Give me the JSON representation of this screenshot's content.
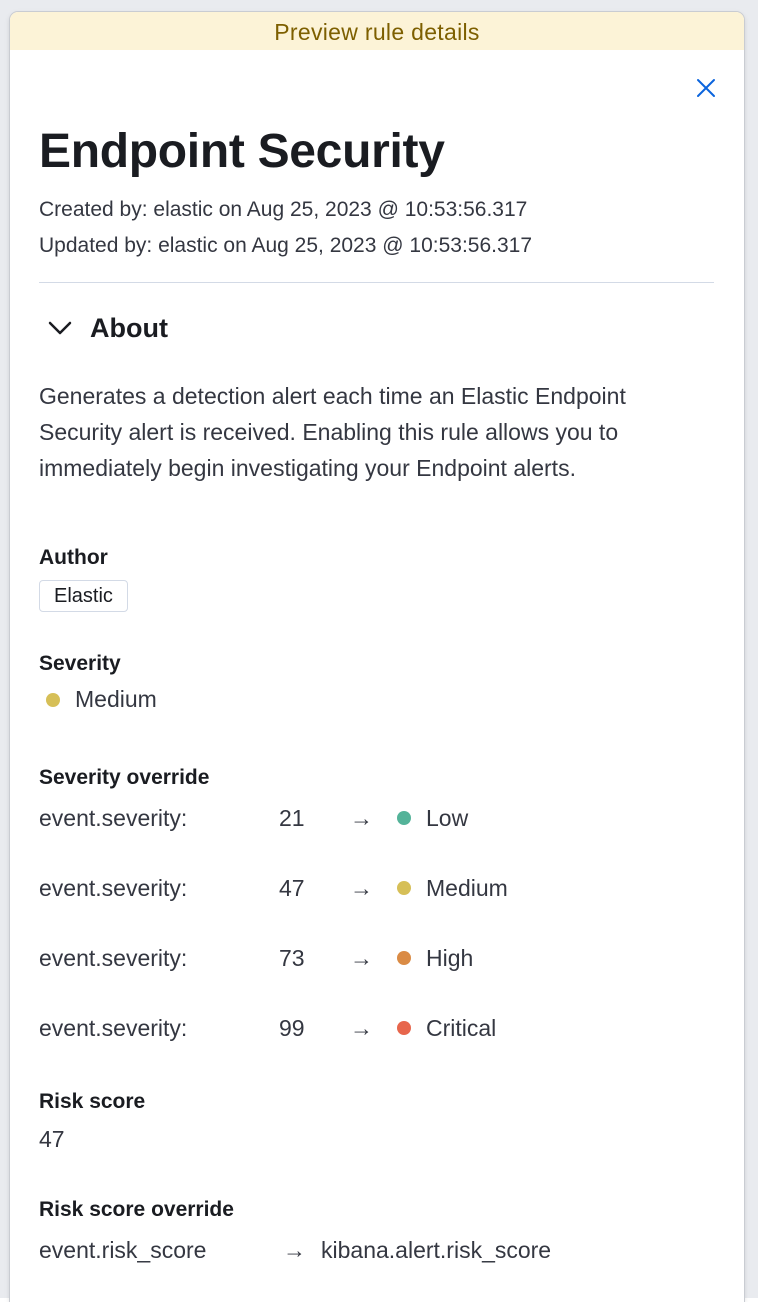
{
  "banner": {
    "text": "Preview rule details"
  },
  "flyout": {
    "close_icon": "close-icon"
  },
  "rule": {
    "name": "Endpoint Security",
    "created_by": "Created by: elastic on Aug 25, 2023 @ 10:53:56.317",
    "updated_by": "Updated by: elastic on Aug 25, 2023 @ 10:53:56.317"
  },
  "about": {
    "section_title": "About",
    "toggle_icon": "chevron-down-icon",
    "description": "Generates a detection alert each time an Elastic Endpoint Security alert is received. Enabling this rule allows you to immediately begin investigating your Endpoint alerts.",
    "author_label": "Author",
    "author_value": "Elastic",
    "severity_label": "Severity",
    "severity_value": "Medium",
    "severity_color": "#d6bf57",
    "severity_override_label": "Severity override",
    "severity_overrides": [
      {
        "field": "event.severity:",
        "value": "21",
        "severity": "Low",
        "color": "#54b399"
      },
      {
        "field": "event.severity:",
        "value": "47",
        "severity": "Medium",
        "color": "#d6bf57"
      },
      {
        "field": "event.severity:",
        "value": "73",
        "severity": "High",
        "color": "#da8b45"
      },
      {
        "field": "event.severity:",
        "value": "99",
        "severity": "Critical",
        "color": "#e7664c"
      }
    ],
    "risk_score_label": "Risk score",
    "risk_score_value": "47",
    "risk_score_override_label": "Risk score override",
    "risk_score_override": {
      "source": "event.risk_score",
      "target": "kibana.alert.risk_score"
    }
  }
}
